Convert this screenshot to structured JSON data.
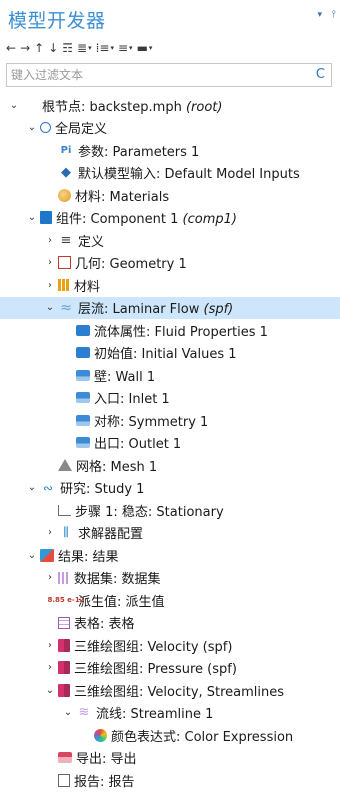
{
  "window": {
    "title": "模型开发器",
    "pin_glyph": "▾",
    "pushpin_glyph": "⫯"
  },
  "toolbar": [
    {
      "name": "back-button",
      "glyph": "←"
    },
    {
      "name": "forward-button",
      "glyph": "→"
    },
    {
      "name": "move-up-button",
      "glyph": "↑"
    },
    {
      "name": "move-down-button",
      "glyph": "↓"
    },
    {
      "name": "show-more-button",
      "glyph": "☶"
    },
    {
      "name": "collapse-menu-button",
      "glyph": "≣",
      "caret": "▾"
    },
    {
      "name": "expand-menu-button",
      "glyph": "⁞≡",
      "caret": "▾"
    },
    {
      "name": "view-menu-button",
      "glyph": "≡",
      "caret": "▾"
    },
    {
      "name": "pin-menu-button",
      "glyph": "▬",
      "caret": "▾"
    }
  ],
  "filter": {
    "placeholder": "键入过滤文本",
    "refresh_glyph": "C"
  },
  "tree": [
    {
      "level": 0,
      "toggle": "⌄",
      "icon": "root",
      "text": "根节点: backstep.mph ",
      "italic": "(root)"
    },
    {
      "level": 1,
      "toggle": "⌄",
      "icon": "globe",
      "text": "全局定义"
    },
    {
      "level": 2,
      "toggle": "",
      "icon": "pi",
      "icon_text": "Pi",
      "text": "参数: Parameters 1"
    },
    {
      "level": 2,
      "toggle": "",
      "icon": "model",
      "icon_text": "◆",
      "text": "默认模型输入: Default Model Inputs"
    },
    {
      "level": 2,
      "toggle": "",
      "icon": "mat",
      "text": "材料: Materials"
    },
    {
      "level": 1,
      "toggle": "⌄",
      "icon": "comp",
      "text": "组件: Component 1 ",
      "italic": "(comp1)"
    },
    {
      "level": 2,
      "toggle": "›",
      "icon": "def",
      "icon_text": "≡",
      "text": "定义"
    },
    {
      "level": 2,
      "toggle": "›",
      "icon": "geom",
      "text": "几何: Geometry 1"
    },
    {
      "level": 2,
      "toggle": "›",
      "icon": "mats",
      "text": "材料"
    },
    {
      "level": 2,
      "toggle": "⌄",
      "icon": "flow",
      "icon_text": "≈",
      "text": "层流: Laminar Flow ",
      "italic": "(spf)",
      "selected": true
    },
    {
      "level": 3,
      "toggle": "",
      "icon": "fluid",
      "text": "流体属性: Fluid Properties 1"
    },
    {
      "level": 3,
      "toggle": "",
      "icon": "fluid",
      "text": "初始值: Initial Values 1"
    },
    {
      "level": 3,
      "toggle": "",
      "icon": "wall",
      "text": "壁: Wall 1"
    },
    {
      "level": 3,
      "toggle": "",
      "icon": "wall",
      "text": "入口: Inlet 1"
    },
    {
      "level": 3,
      "toggle": "",
      "icon": "wall",
      "text": "对称: Symmetry 1"
    },
    {
      "level": 3,
      "toggle": "",
      "icon": "wall",
      "text": "出口: Outlet 1"
    },
    {
      "level": 2,
      "toggle": "",
      "icon": "mesh",
      "text": "网格: Mesh 1"
    },
    {
      "level": 1,
      "toggle": "⌄",
      "icon": "study",
      "icon_text": "∾",
      "text": "研究: Study 1"
    },
    {
      "level": 2,
      "toggle": "",
      "icon": "step",
      "text": "步骤 1: 稳态: Stationary"
    },
    {
      "level": 2,
      "toggle": "›",
      "icon": "solver",
      "icon_text": "⫼",
      "text": "求解器配置"
    },
    {
      "level": 1,
      "toggle": "⌄",
      "icon": "results",
      "text": "结果: 结果"
    },
    {
      "level": 2,
      "toggle": "›",
      "icon": "dataset",
      "text": "数据集: 数据集"
    },
    {
      "level": 2,
      "toggle": "",
      "icon": "derived",
      "icon_text": "8.85 e-12",
      "text": "派生值: 派生值"
    },
    {
      "level": 2,
      "toggle": "",
      "icon": "table",
      "text": "表格: 表格"
    },
    {
      "level": 2,
      "toggle": "›",
      "icon": "3d",
      "text": "三维绘图组: Velocity (spf)"
    },
    {
      "level": 2,
      "toggle": "›",
      "icon": "3d",
      "text": "三维绘图组: Pressure (spf)"
    },
    {
      "level": 2,
      "toggle": "⌄",
      "icon": "3d",
      "text": "三维绘图组: Velocity, Streamlines"
    },
    {
      "level": 3,
      "toggle": "⌄",
      "icon": "stream",
      "icon_text": "≋",
      "text": "流线: Streamline 1"
    },
    {
      "level": 4,
      "toggle": "",
      "icon": "color",
      "text": "颜色表达式: Color Expression"
    },
    {
      "level": 2,
      "toggle": "",
      "icon": "export",
      "text": "导出: 导出"
    },
    {
      "level": 2,
      "toggle": "",
      "icon": "report",
      "text": "报告: 报告"
    }
  ],
  "colors": {
    "title": "#3d8fd6",
    "selection": "#cde6fb",
    "accent": "#1e76c8"
  }
}
